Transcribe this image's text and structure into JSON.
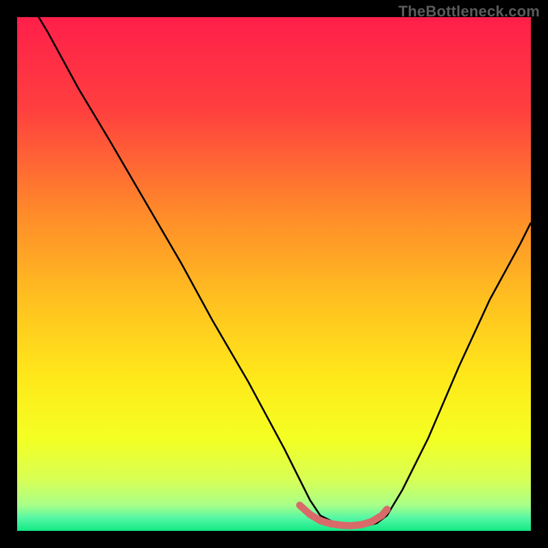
{
  "watermark": "TheBottleneck.com",
  "gradient": {
    "stops": [
      {
        "offset": 0.0,
        "color": "#ff1f4a"
      },
      {
        "offset": 0.18,
        "color": "#ff3f3f"
      },
      {
        "offset": 0.38,
        "color": "#ff8a2a"
      },
      {
        "offset": 0.55,
        "color": "#ffc020"
      },
      {
        "offset": 0.7,
        "color": "#ffe81a"
      },
      {
        "offset": 0.82,
        "color": "#f4ff22"
      },
      {
        "offset": 0.9,
        "color": "#d8ff55"
      },
      {
        "offset": 0.95,
        "color": "#a8ff88"
      },
      {
        "offset": 0.975,
        "color": "#55f7a5"
      },
      {
        "offset": 1.0,
        "color": "#12e884"
      }
    ]
  },
  "chart_data": {
    "type": "line",
    "title": "",
    "xlabel": "",
    "ylabel": "",
    "xlim": [
      0,
      100
    ],
    "ylim": [
      0,
      100
    ],
    "series": [
      {
        "name": "curve",
        "stroke": "#000000",
        "x": [
          0,
          6,
          12,
          18,
          25,
          32,
          38,
          45,
          52,
          55,
          57,
          59,
          62,
          65,
          68,
          70,
          72,
          75,
          80,
          86,
          92,
          98,
          100
        ],
        "values": [
          107,
          97,
          86,
          76,
          64,
          52,
          41,
          29,
          16,
          10,
          6,
          3,
          1.5,
          1,
          1,
          1.5,
          3,
          8,
          18,
          32,
          45,
          56,
          60
        ]
      },
      {
        "name": "bottom-marker",
        "stroke": "#d86a6a",
        "strokeWidth": 9,
        "x": [
          55,
          57,
          59,
          61,
          63,
          65,
          67,
          69,
          71,
          72
        ],
        "values": [
          5,
          3.2,
          2,
          1.4,
          1.1,
          1,
          1.2,
          1.8,
          3,
          4.2
        ]
      }
    ]
  }
}
